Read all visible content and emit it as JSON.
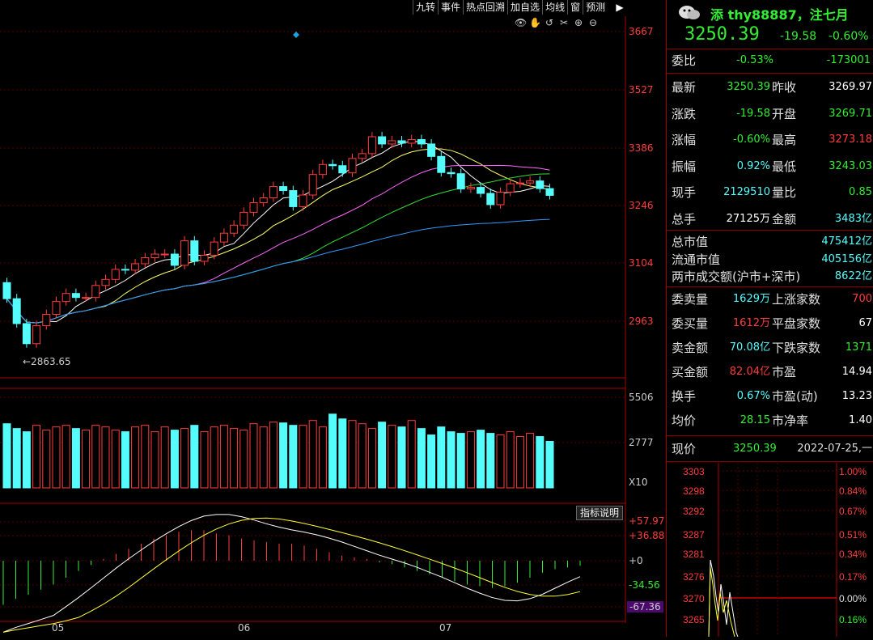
{
  "toolbar": {
    "items": [
      "九转",
      "事件",
      "热点回溯",
      "加自选",
      "均线",
      "窗",
      "预测"
    ]
  },
  "price_axis": [
    "3667",
    "3527",
    "3386",
    "3246",
    "3104",
    "2963"
  ],
  "low_label": "←2863.65",
  "vol_axis": [
    "5506",
    "2777"
  ],
  "vol_unit": "X10",
  "macd_axis": [
    "+57.97",
    "+36.88",
    "+0",
    "-34.56",
    "-67.36"
  ],
  "macd_button": "指标说明",
  "date_labels": [
    "05",
    "06",
    "07"
  ],
  "header": {
    "title": "添 thy88887，注七月",
    "price": "3250.39",
    "change": "-19.58",
    "pct": "-0.60%"
  },
  "quote": {
    "weibi_label": "委比",
    "weibi": "-0.53%",
    "weibi_num": "-173001",
    "rows": [
      {
        "l1": "最新",
        "v1": "3250.39",
        "c1": "#33ee33",
        "l2": "昨收",
        "v2": "3269.97",
        "c2": "#ffffff"
      },
      {
        "l1": "涨跌",
        "v1": "-19.58",
        "c1": "#33ee33",
        "l2": "开盘",
        "v2": "3269.71",
        "c2": "#33ee33"
      },
      {
        "l1": "涨幅",
        "v1": "-0.60%",
        "c1": "#33ee33",
        "l2": "最高",
        "v2": "3273.18",
        "c2": "#ff3c3c"
      },
      {
        "l1": "振幅",
        "v1": "0.92%",
        "c1": "#54fcfc",
        "l2": "最低",
        "v2": "3243.03",
        "c2": "#33ee33"
      },
      {
        "l1": "现手",
        "v1": "2129510",
        "c1": "#54fcfc",
        "l2": "量比",
        "v2": "0.85",
        "c2": "#33ee33"
      },
      {
        "l1": "总手",
        "v1": "27125万",
        "c1": "#ffffff",
        "l2": "金额",
        "v2": "3483亿",
        "c2": "#54fcfc"
      }
    ],
    "mkt": [
      {
        "l": "总市值",
        "v": "475412亿"
      },
      {
        "l": "流通市值",
        "v": "405156亿"
      },
      {
        "l": "两市成交额(沪市+深市)",
        "v": "8622亿"
      }
    ],
    "rows2": [
      {
        "l1": "委卖量",
        "v1": "1629万",
        "c1": "#54fcfc",
        "l2": "上涨家数",
        "v2": "700",
        "c2": "#ff3c3c"
      },
      {
        "l1": "委买量",
        "v1": "1612万",
        "c1": "#ff3c3c",
        "l2": "平盘家数",
        "v2": "67",
        "c2": "#ffffff"
      },
      {
        "l1": "卖金额",
        "v1": "70.08亿",
        "c1": "#54fcfc",
        "l2": "下跌家数",
        "v2": "1371",
        "c2": "#33ee33"
      },
      {
        "l1": "买金额",
        "v1": "82.04亿",
        "c1": "#ff3c3c",
        "l2": "市盈",
        "v2": "14.94",
        "c2": "#ffffff"
      },
      {
        "l1": "换手",
        "v1": "0.67%",
        "c1": "#54fcfc",
        "l2": "市盈(动)",
        "v2": "13.23",
        "c2": "#ffffff"
      },
      {
        "l1": "均价",
        "v1": "28.15",
        "c1": "#33ee33",
        "l2": "市净率",
        "v2": "1.40",
        "c2": "#ffffff"
      }
    ],
    "now_label": "现价",
    "now_val": "3250.39",
    "now_date": "2022-07-25,一"
  },
  "mini_axis_left": [
    "3303",
    "3298",
    "3292",
    "3287",
    "3281",
    "3276",
    "3270",
    "3265"
  ],
  "mini_axis_right": [
    "1.00%",
    "0.84%",
    "0.67%",
    "0.51%",
    "0.34%",
    "0.17%",
    "0.00%",
    "0.16%"
  ],
  "chart_data": {
    "type": "candlestick",
    "closes": [
      2997,
      2935,
      2885,
      2930,
      2958,
      2990,
      3010,
      3000,
      3000,
      3030,
      3045,
      3070,
      3068,
      3084,
      3099,
      3108,
      3108,
      3080,
      3141,
      3090,
      3105,
      3138,
      3160,
      3180,
      3212,
      3236,
      3248,
      3276,
      3266,
      3226,
      3255,
      3306,
      3331,
      3328,
      3310,
      3346,
      3358,
      3400,
      3382,
      3390,
      3384,
      3393,
      3382,
      3351,
      3311,
      3308,
      3270,
      3274,
      3259,
      3231,
      3262,
      3283,
      3285,
      3290,
      3271,
      3254
    ],
    "volumes": [
      4000,
      3700,
      3500,
      3900,
      3600,
      3800,
      3900,
      3700,
      3600,
      3900,
      3800,
      3600,
      3500,
      3800,
      3900,
      3500,
      3800,
      3600,
      3700,
      3900,
      3500,
      3800,
      3900,
      3700,
      3600,
      4000,
      3800,
      4100,
      4050,
      3900,
      3900,
      4200,
      3800,
      4600,
      4300,
      4200,
      4000,
      3700,
      4100,
      3900,
      3800,
      4200,
      3700,
      3300,
      3800,
      3500,
      3400,
      3500,
      3600,
      3400,
      3300,
      3500,
      3200,
      3400,
      3200,
      2900
    ],
    "macd": [
      -52,
      -45,
      -40,
      -34,
      -28,
      -20,
      -12,
      -5,
      2,
      8,
      14,
      20,
      26,
      30,
      34,
      36,
      36,
      32,
      30,
      26,
      24,
      22,
      20,
      20,
      18,
      14,
      10,
      6,
      4,
      2,
      -2,
      -4,
      -8,
      -12,
      -16,
      -20,
      -24,
      -28,
      -30,
      -32,
      -30,
      -26,
      -20,
      -14,
      -10,
      -8,
      -6
    ]
  }
}
